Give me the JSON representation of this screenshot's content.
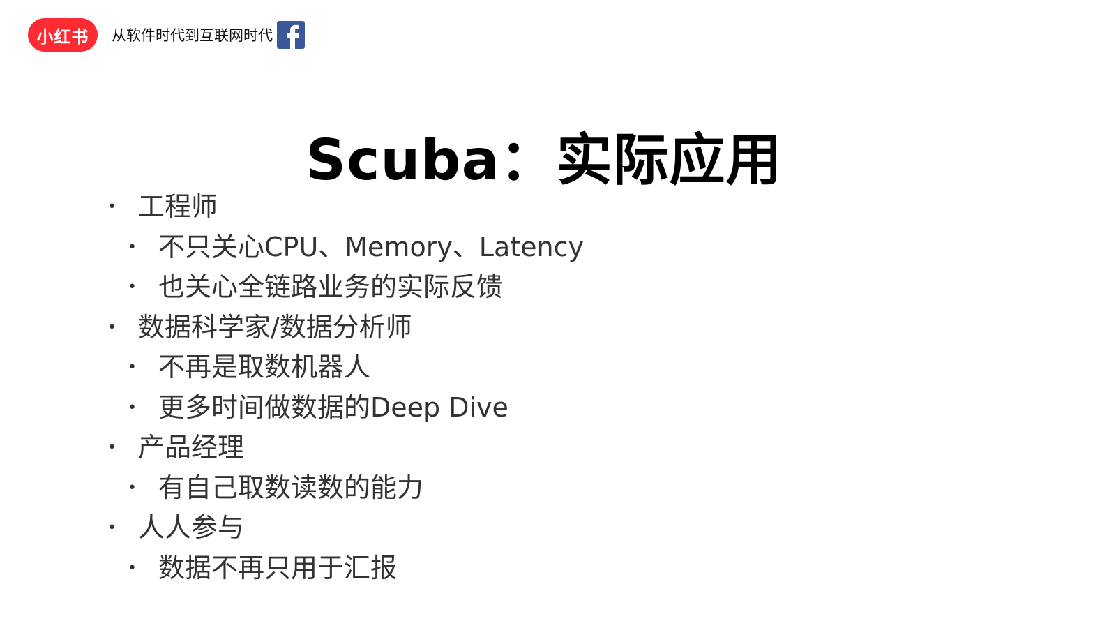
{
  "header": {
    "brand_badge": "小红书",
    "subtitle": "从软件时代到互联网时代",
    "icon": "facebook-icon",
    "brand_color": "#fe2c32",
    "facebook_color": "#3b5998"
  },
  "slide": {
    "title": "Scuba：实际应用",
    "bullets": [
      {
        "level": 1,
        "text": "工程师"
      },
      {
        "level": 2,
        "text": "不只关心CPU、Memory、Latency"
      },
      {
        "level": 2,
        "text": "也关心全链路业务的实际反馈"
      },
      {
        "level": 1,
        "text": "数据科学家/数据分析师"
      },
      {
        "level": 2,
        "text": "不再是取数机器人"
      },
      {
        "level": 2,
        "text": "更多时间做数据的Deep Dive"
      },
      {
        "level": 1,
        "text": "产品经理"
      },
      {
        "level": 2,
        "text": "有自己取数读数的能力"
      },
      {
        "level": 1,
        "text": "人人参与"
      },
      {
        "level": 2,
        "text": "数据不再只用于汇报"
      }
    ],
    "bullet_glyph": "•"
  }
}
